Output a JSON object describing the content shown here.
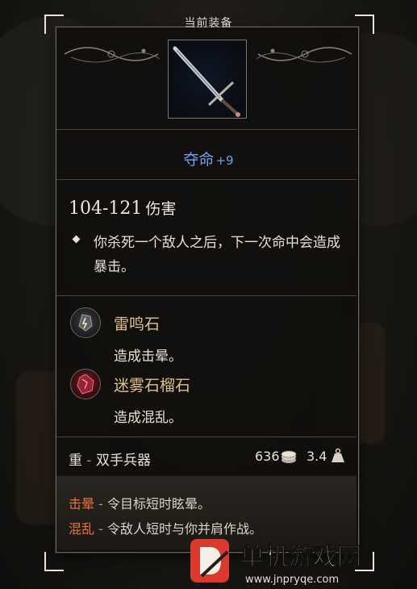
{
  "header": {
    "label": "当前装备"
  },
  "item": {
    "name": "夺命",
    "enchant": "+9",
    "damage_range": "104-121",
    "damage_unit": "伤害",
    "passive": "你杀死一个敌人之后，下一次命中会造成暴击。"
  },
  "runes": [
    {
      "name": "雷鸣石",
      "effect": "造成击晕。",
      "icon": "thunder-stone-icon"
    },
    {
      "name": "迷雾石榴石",
      "effect": "造成混乱。",
      "icon": "garnet-icon"
    }
  ],
  "stats": {
    "weight_class": "重",
    "weapon_type": "双手兵器",
    "price": "636",
    "weight": "3.4"
  },
  "status_effects": [
    {
      "keyword": "击晕",
      "description": "令目标短时眩晕。"
    },
    {
      "keyword": "混乱",
      "description": "令敌人短时与你并肩作战。"
    }
  ],
  "colors": {
    "item_name": "#6fa0e8",
    "rune_name": "#e2c08a",
    "status_keyword": "#e8743a"
  },
  "watermark": {
    "brand": "单机游戏网",
    "url": "www.jnpryqe.com"
  }
}
